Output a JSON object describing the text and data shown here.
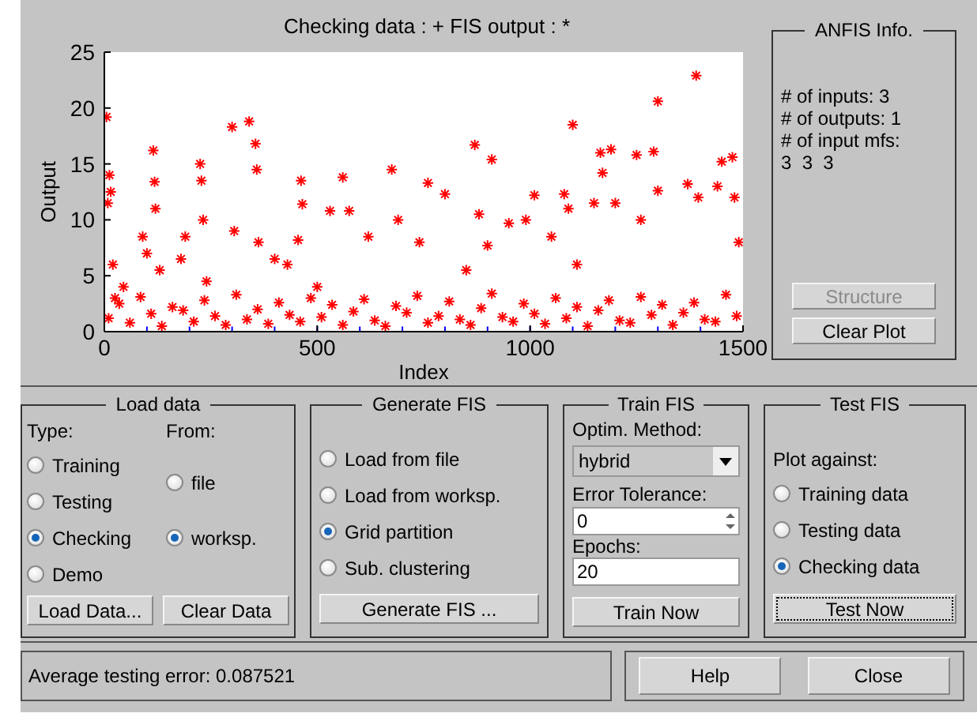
{
  "plot": {
    "legend": [
      {
        "kind": "plus",
        "suffix": ": +"
      },
      {
        "kind": "star",
        "suffix": ": *"
      }
    ],
    "chart_data": {
      "type": "scatter",
      "xlabel": "Index",
      "ylabel": "Output",
      "xlim": [
        0,
        1500
      ],
      "ylim": [
        0,
        25
      ],
      "xticks": [
        0,
        500,
        1000,
        1500
      ],
      "yticks": [
        0,
        5,
        10,
        15,
        20,
        25
      ],
      "series": [
        {
          "name": "Checking data",
          "color": "#0000ff",
          "x": [
            100,
            200,
            300,
            400,
            500,
            600,
            700,
            800,
            900,
            1000,
            1100,
            1200,
            1300,
            1400
          ],
          "values": [
            0,
            0,
            0,
            0,
            0,
            0,
            0,
            0,
            0,
            0,
            0,
            0,
            0,
            0
          ]
        },
        {
          "name": "FIS output",
          "color": "#ff0000",
          "x": [
            5,
            8,
            12,
            15,
            20,
            25,
            45,
            90,
            100,
            115,
            118,
            120,
            130,
            180,
            190,
            225,
            228,
            232,
            240,
            300,
            305,
            340,
            355,
            358,
            362,
            400,
            430,
            455,
            462,
            465,
            500,
            530,
            560,
            575,
            620,
            675,
            690,
            740,
            760,
            800,
            850,
            870,
            880,
            900,
            910,
            950,
            990,
            1010,
            1050,
            1080,
            1090,
            1100,
            1110,
            1150,
            1165,
            1170,
            1190,
            1200,
            1250,
            1260,
            1290,
            1300,
            1300,
            1370,
            1390,
            1395,
            1440,
            1450,
            1475,
            1480,
            1490,
            10,
            35,
            60,
            85,
            110,
            135,
            160,
            185,
            210,
            235,
            260,
            285,
            310,
            335,
            360,
            385,
            410,
            435,
            460,
            485,
            510,
            535,
            560,
            585,
            610,
            635,
            660,
            685,
            710,
            735,
            760,
            785,
            810,
            835,
            860,
            885,
            910,
            935,
            960,
            985,
            1010,
            1035,
            1060,
            1085,
            1110,
            1135,
            1160,
            1185,
            1210,
            1235,
            1260,
            1285,
            1310,
            1335,
            1360,
            1385,
            1410,
            1435,
            1460,
            1485
          ],
          "values": [
            19.2,
            11.5,
            14,
            12.5,
            6,
            3,
            4,
            8.5,
            7,
            16.2,
            13.4,
            11,
            5.5,
            6.5,
            8.5,
            15,
            13.5,
            10,
            4.5,
            18.3,
            9,
            18.8,
            16.8,
            14.5,
            8,
            6.5,
            6,
            8.2,
            13.5,
            11.4,
            4,
            10.8,
            13.8,
            10.8,
            8.5,
            14.5,
            10,
            8,
            13.3,
            12.3,
            5.5,
            16.7,
            10.5,
            7.7,
            15.4,
            9.7,
            10,
            12.2,
            8.5,
            12.3,
            11,
            18.5,
            6,
            11.5,
            16,
            14.2,
            16.3,
            11.5,
            15.8,
            10,
            16.1,
            20.6,
            12.6,
            13.2,
            22.9,
            12,
            13,
            15.2,
            15.6,
            12,
            8,
            1.2,
            2.5,
            0.8,
            3.1,
            1.6,
            0.5,
            2.2,
            1.9,
            0.9,
            2.8,
            1.4,
            0.6,
            3.3,
            1.1,
            2.0,
            0.7,
            2.6,
            1.5,
            0.9,
            3.0,
            1.3,
            2.4,
            0.6,
            1.8,
            2.9,
            1.0,
            0.5,
            2.3,
            1.7,
            3.2,
            0.8,
            1.4,
            2.7,
            1.1,
            0.6,
            2.1,
            3.4,
            1.3,
            0.9,
            2.5,
            1.6,
            0.7,
            3.0,
            1.2,
            2.2,
            0.5,
            1.9,
            2.8,
            1.0,
            0.8,
            3.1,
            1.5,
            2.4,
            0.6,
            1.7,
            2.6,
            1.1,
            0.9,
            3.3,
            1.4
          ]
        }
      ]
    }
  },
  "anfis_info": {
    "title": "ANFIS Info.",
    "lines": [
      "# of inputs: 3",
      "# of outputs: 1",
      "# of input mfs:",
      "3  3  3"
    ],
    "buttons": [
      {
        "label": "Structure",
        "disabled": true
      },
      {
        "label": "Clear Plot",
        "disabled": false
      }
    ]
  },
  "load_data": {
    "title": "Load data",
    "type_label": "Type:",
    "from_label": "From:",
    "type_options": [
      {
        "label": "Training",
        "selected": false
      },
      {
        "label": "Testing",
        "selected": false
      },
      {
        "label": "Checking",
        "selected": true
      },
      {
        "label": "Demo",
        "selected": false
      }
    ],
    "from_options": [
      {
        "label": "file",
        "selected": false
      },
      {
        "label": "worksp.",
        "selected": true
      }
    ],
    "buttons": [
      "Load Data...",
      "Clear Data"
    ]
  },
  "generate_fis": {
    "title": "Generate FIS",
    "options": [
      {
        "label": "Load from file",
        "selected": false
      },
      {
        "label": "Load from worksp.",
        "selected": false
      },
      {
        "label": "Grid partition",
        "selected": true
      },
      {
        "label": "Sub. clustering",
        "selected": false
      }
    ],
    "button": "Generate FIS ..."
  },
  "train_fis": {
    "title": "Train FIS",
    "method_label": "Optim. Method:",
    "method": "hybrid",
    "tolerance_label": "Error Tolerance:",
    "tolerance": "0",
    "epochs_label": "Epochs:",
    "epochs": "20",
    "button": "Train Now"
  },
  "test_fis": {
    "title": "Test FIS",
    "plot_label": "Plot against:",
    "options": [
      {
        "label": "Training data",
        "selected": false
      },
      {
        "label": "Testing data",
        "selected": false
      },
      {
        "label": "Checking data",
        "selected": true
      }
    ],
    "button": {
      "label": "Test Now",
      "focused": true
    }
  },
  "status": "Average testing error: 0.087521",
  "buttons": [
    "Help",
    "Close"
  ]
}
